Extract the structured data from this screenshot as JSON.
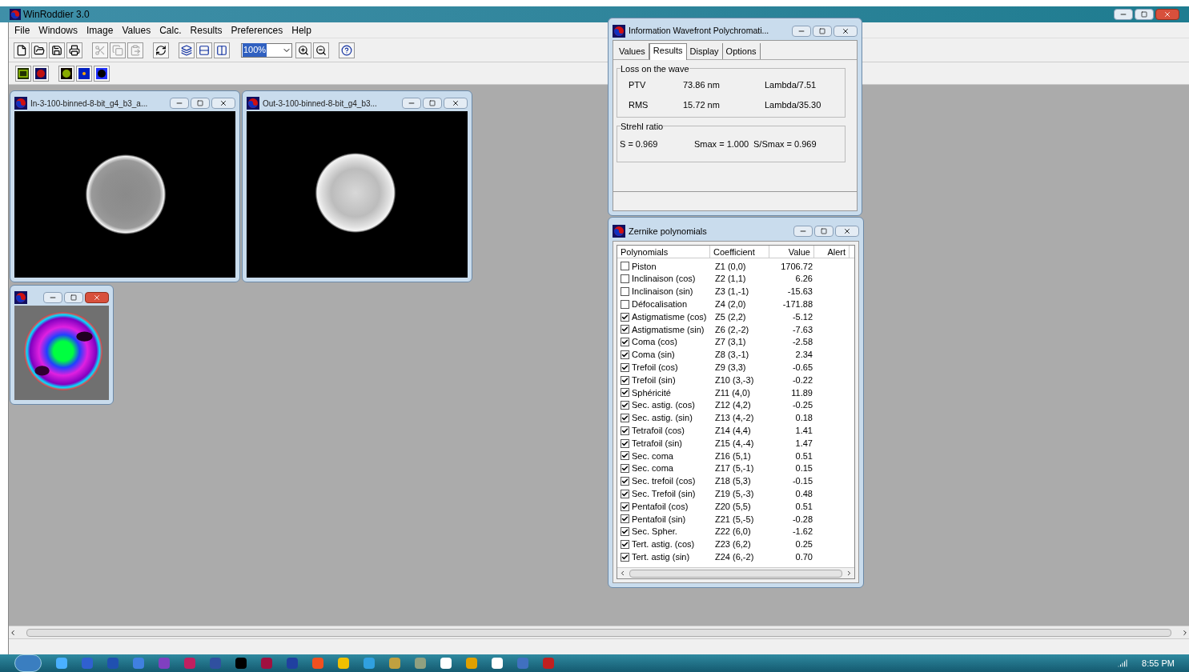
{
  "app": {
    "title": "WinRoddier 3.0"
  },
  "menu": [
    "File",
    "Windows",
    "Image",
    "Values",
    "Calc.",
    "Results",
    "Preferences",
    "Help"
  ],
  "toolbar": {
    "buttons": [
      {
        "disabled": false
      },
      {
        "disabled": false
      },
      {
        "disabled": false
      },
      {
        "disabled": false
      },
      {
        "disabled": true
      },
      {
        "disabled": true
      },
      {
        "disabled": true
      },
      {
        "disabled": false
      },
      {
        "disabled": false
      },
      {
        "disabled": false
      },
      {
        "disabled": false
      },
      {
        "disabled": false
      },
      {
        "disabled": false
      },
      {
        "disabled": false
      }
    ],
    "zoom": "100%"
  },
  "image_windows": [
    {
      "title": "In-3-100-binned-8-bit_g4_b3_a..."
    },
    {
      "title": "Out-3-100-binned-8-bit_g4_b3..."
    }
  ],
  "info_window": {
    "title": "Information Wavefront Polychromati...",
    "tabs": [
      {
        "label": "Values",
        "selected": false
      },
      {
        "label": "Results",
        "selected": true
      },
      {
        "label": "Display",
        "selected": false
      },
      {
        "label": "Options",
        "selected": false
      }
    ],
    "loss": {
      "title": "Loss on the wave",
      "rows": [
        {
          "label": "PTV",
          "value": "73.86 nm",
          "lambda": "Lambda/7.51"
        },
        {
          "label": "RMS",
          "value": "15.72 nm",
          "lambda": "Lambda/35.30"
        }
      ]
    },
    "strehl": {
      "title": "Strehl ratio",
      "items": [
        "S = 0.969",
        "Smax = 1.000",
        "S/Smax = 0.969"
      ]
    }
  },
  "zernike_window": {
    "title": "Zernike polynomials",
    "columns": [
      "Polynomials",
      "Coefficient",
      "Value",
      "Alert"
    ],
    "rows": [
      {
        "name": "Piston",
        "coefficient": "Z1 (0,0)",
        "value": "1706.72",
        "checked": false
      },
      {
        "name": "Inclinaison (cos)",
        "coefficient": "Z2 (1,1)",
        "value": "6.26",
        "checked": false
      },
      {
        "name": "Inclinaison (sin)",
        "coefficient": "Z3 (1,-1)",
        "value": "-15.63",
        "checked": false
      },
      {
        "name": "Défocalisation",
        "coefficient": "Z4 (2,0)",
        "value": "-171.88",
        "checked": false
      },
      {
        "name": "Astigmatisme (cos)",
        "coefficient": "Z5 (2,2)",
        "value": "-5.12",
        "checked": true
      },
      {
        "name": "Astigmatisme (sin)",
        "coefficient": "Z6 (2,-2)",
        "value": "-7.63",
        "checked": true
      },
      {
        "name": "Coma (cos)",
        "coefficient": "Z7 (3,1)",
        "value": "-2.58",
        "checked": true
      },
      {
        "name": "Coma (sin)",
        "coefficient": "Z8 (3,-1)",
        "value": "2.34",
        "checked": true
      },
      {
        "name": "Trefoil (cos)",
        "coefficient": "Z9 (3,3)",
        "value": "-0.65",
        "checked": true
      },
      {
        "name": "Trefoil (sin)",
        "coefficient": "Z10 (3,-3)",
        "value": "-0.22",
        "checked": true
      },
      {
        "name": "Sphéricité",
        "coefficient": "Z11 (4,0)",
        "value": "11.89",
        "checked": true
      },
      {
        "name": "Sec. astig. (cos)",
        "coefficient": "Z12 (4,2)",
        "value": "-0.25",
        "checked": true
      },
      {
        "name": "Sec. astig. (sin)",
        "coefficient": "Z13 (4,-2)",
        "value": "0.18",
        "checked": true
      },
      {
        "name": "Tetrafoil (cos)",
        "coefficient": "Z14 (4,4)",
        "value": "1.41",
        "checked": true
      },
      {
        "name": "Tetrafoil (sin)",
        "coefficient": "Z15 (4,-4)",
        "value": "1.47",
        "checked": true
      },
      {
        "name": "Sec. coma",
        "coefficient": "Z16 (5,1)",
        "value": "0.51",
        "checked": true
      },
      {
        "name": "Sec. coma",
        "coefficient": "Z17 (5,-1)",
        "value": "0.15",
        "checked": true
      },
      {
        "name": "Sec. trefoil (cos)",
        "coefficient": "Z18 (5,3)",
        "value": "-0.15",
        "checked": true
      },
      {
        "name": "Sec. Trefoil (sin)",
        "coefficient": "Z19 (5,-3)",
        "value": "0.48",
        "checked": true
      },
      {
        "name": "Pentafoil (cos)",
        "coefficient": "Z20 (5,5)",
        "value": "0.51",
        "checked": true
      },
      {
        "name": "Pentafoil (sin)",
        "coefficient": "Z21 (5,-5)",
        "value": "-0.28",
        "checked": true
      },
      {
        "name": "Sec. Spher.",
        "coefficient": "Z22 (6,0)",
        "value": "-1.62",
        "checked": true
      },
      {
        "name": "Tert. astig. (cos)",
        "coefficient": "Z23 (6,2)",
        "value": "0.25",
        "checked": true
      },
      {
        "name": "Tert. astig (sin)",
        "coefficient": "Z24 (6,-2)",
        "value": "0.70",
        "checked": true
      }
    ]
  },
  "taskbar": {
    "clock": "8:55 PM"
  }
}
